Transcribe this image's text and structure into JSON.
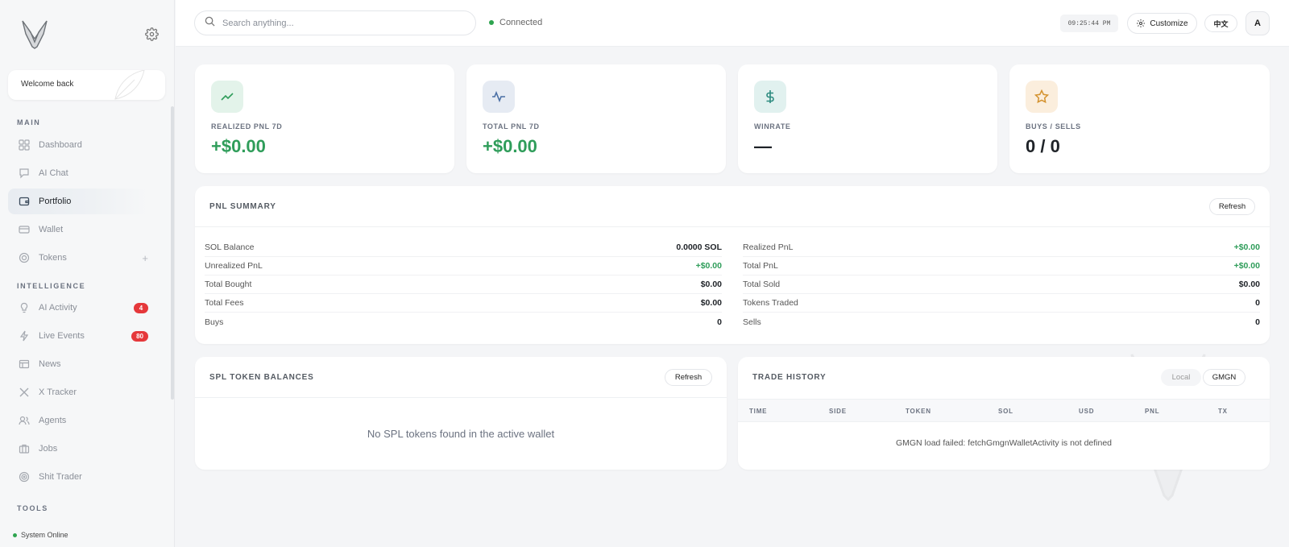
{
  "sidebar": {
    "welcome": "Welcome back",
    "sections": {
      "main": "MAIN",
      "intelligence": "INTELLIGENCE",
      "tools": "TOOLS"
    },
    "main_items": [
      {
        "label": "Dashboard",
        "icon": "grid-icon"
      },
      {
        "label": "AI Chat",
        "icon": "chat-icon"
      },
      {
        "label": "Portfolio",
        "icon": "wallet-icon",
        "active": true
      },
      {
        "label": "Wallet",
        "icon": "card-icon"
      },
      {
        "label": "Tokens",
        "icon": "coin-icon",
        "action": "+"
      }
    ],
    "intel_items": [
      {
        "label": "AI Activity",
        "icon": "lightbulb-icon",
        "badge": "4"
      },
      {
        "label": "Live Events",
        "icon": "bolt-icon",
        "badge": "80"
      },
      {
        "label": "News",
        "icon": "newspaper-icon"
      },
      {
        "label": "X Tracker",
        "icon": "x-icon"
      },
      {
        "label": "Agents",
        "icon": "users-icon"
      },
      {
        "label": "Jobs",
        "icon": "briefcase-icon"
      },
      {
        "label": "Shit Trader",
        "icon": "target-icon"
      }
    ],
    "status": "System Online"
  },
  "topbar": {
    "search_placeholder": "Search anything...",
    "connection": "Connected",
    "clock": "09:25:44 PM",
    "customize": "Customize",
    "language": "中文",
    "avatar": "A"
  },
  "stats": [
    {
      "label": "REALIZED PNL 7D",
      "value": "+$0.00",
      "icon": "trend-up-icon",
      "tone": "green"
    },
    {
      "label": "TOTAL PNL 7D",
      "value": "+$0.00",
      "icon": "activity-icon",
      "tone": "green"
    },
    {
      "label": "WINRATE",
      "value": "—",
      "icon": "dollar-icon",
      "tone": "dark"
    },
    {
      "label": "BUYS / SELLS",
      "value": "0 / 0",
      "icon": "star-icon",
      "tone": "dark"
    }
  ],
  "pnl_summary": {
    "title": "PNL SUMMARY",
    "refresh": "Refresh",
    "left": [
      {
        "k": "SOL Balance",
        "v": "0.0000 SOL"
      },
      {
        "k": "Unrealized PnL",
        "v": "+$0.00",
        "green": true
      },
      {
        "k": "Total Bought",
        "v": "$0.00"
      },
      {
        "k": "Total Fees",
        "v": "$0.00"
      },
      {
        "k": "Buys",
        "v": "0"
      }
    ],
    "right": [
      {
        "k": "Realized PnL",
        "v": "+$0.00",
        "green": true
      },
      {
        "k": "Total PnL",
        "v": "+$0.00",
        "green": true
      },
      {
        "k": "Total Sold",
        "v": "$0.00"
      },
      {
        "k": "Tokens Traded",
        "v": "0"
      },
      {
        "k": "Sells",
        "v": "0"
      }
    ]
  },
  "spl": {
    "title": "SPL TOKEN BALANCES",
    "refresh": "Refresh",
    "empty": "No SPL tokens found in the active wallet"
  },
  "trades": {
    "title": "TRADE HISTORY",
    "seg_local": "Local",
    "seg_gmgn": "GMGN",
    "columns": [
      "TIME",
      "SIDE",
      "TOKEN",
      "SOL",
      "USD",
      "PNL",
      "TX"
    ],
    "error": "GMGN load failed: fetchGmgnWalletActivity is not defined"
  }
}
